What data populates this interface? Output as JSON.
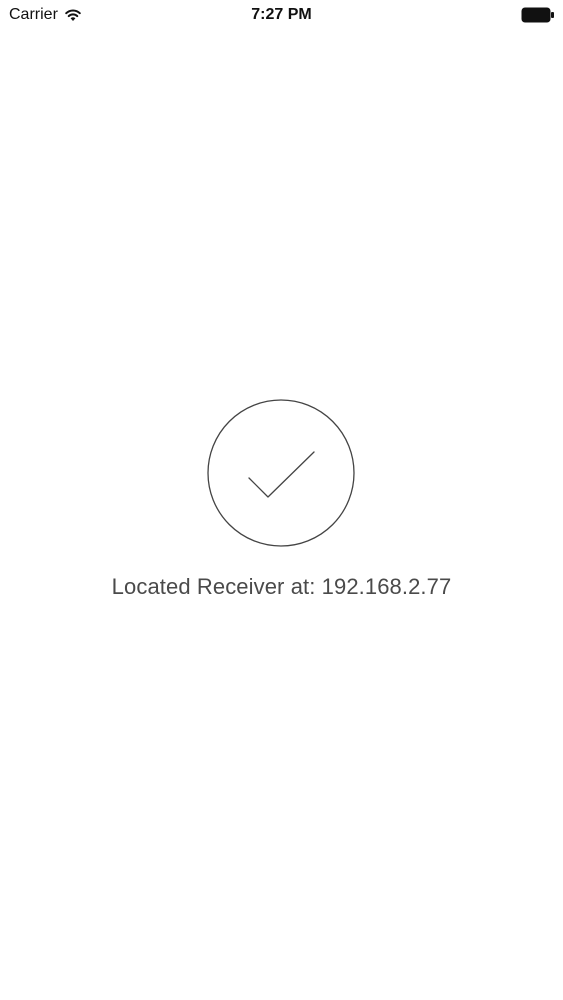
{
  "status_bar": {
    "carrier": "Carrier",
    "time": "7:27 PM",
    "icons": {
      "wifi": "wifi-icon",
      "battery": "battery-icon"
    }
  },
  "main": {
    "status_icon": "checkmark-circle-icon",
    "message": "Located Receiver at: 192.168.2.77"
  },
  "colors": {
    "background": "#ffffff",
    "text": "#4a4a4a",
    "icon_stroke": "#444444"
  }
}
